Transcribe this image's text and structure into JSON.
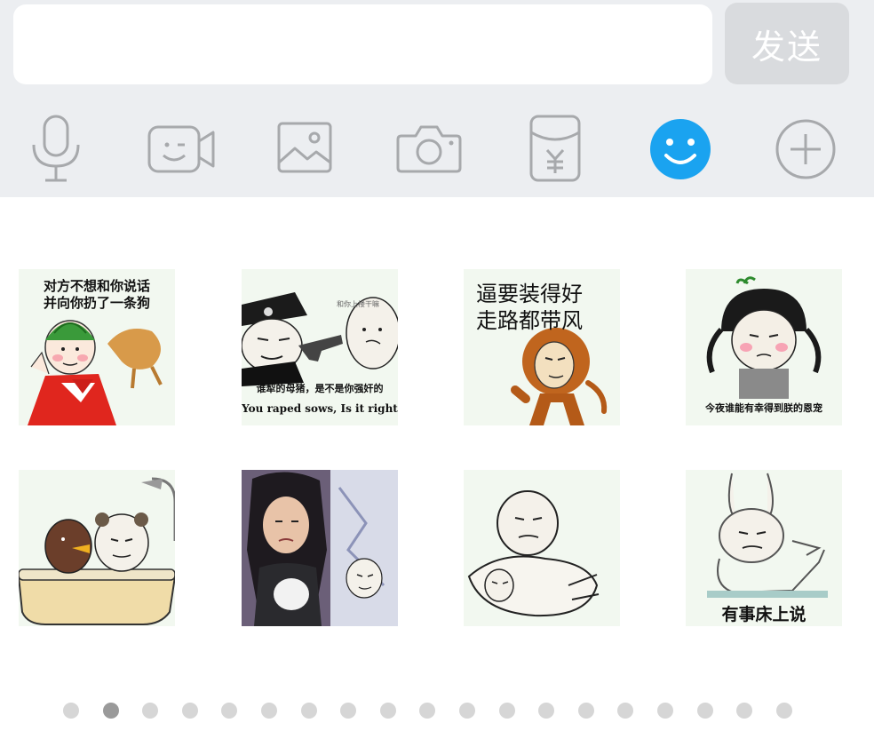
{
  "input": {
    "value": "",
    "placeholder": ""
  },
  "send_button": {
    "label": "发送"
  },
  "toolbar": {
    "items": [
      {
        "icon": "microphone-icon",
        "active": false
      },
      {
        "icon": "video-call-icon",
        "active": false
      },
      {
        "icon": "image-icon",
        "active": false
      },
      {
        "icon": "camera-icon",
        "active": false
      },
      {
        "icon": "red-packet-icon",
        "active": false
      },
      {
        "icon": "emoji-icon",
        "active": true
      },
      {
        "icon": "plus-icon",
        "active": false
      }
    ],
    "active_color": "#1aa3f0",
    "inactive_color": "#a7a9ac"
  },
  "stickers": [
    {
      "name": "sticker-watermelon-dog",
      "lines": [
        "对方不想和你说话",
        "并向你扔了一条狗"
      ]
    },
    {
      "name": "sticker-police-gun",
      "lines": [
        "和你上楼干嘛",
        "谁犁的母猪，是不是你强奸的",
        "You raped sows, Is it right"
      ]
    },
    {
      "name": "sticker-monkey-walk",
      "lines": [
        "逼要装得好",
        "走路都带风"
      ]
    },
    {
      "name": "sticker-pigtail-girl",
      "lines": [
        "今夜谁能有幸得到朕的恩宠"
      ]
    },
    {
      "name": "sticker-bathtub",
      "lines": []
    },
    {
      "name": "sticker-photo-girl",
      "lines": []
    },
    {
      "name": "sticker-panda-hug",
      "lines": []
    },
    {
      "name": "sticker-rabbit-bed",
      "lines": [
        "有事床上说"
      ]
    }
  ],
  "pager": {
    "total": 19,
    "current": 2
  }
}
